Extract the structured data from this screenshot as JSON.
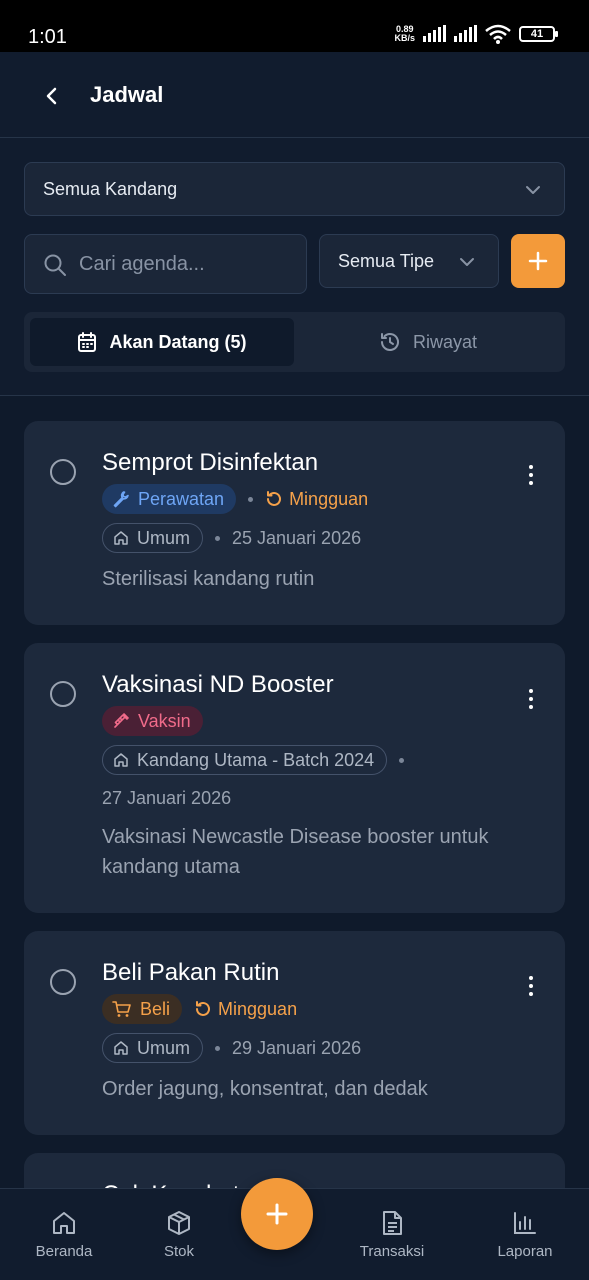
{
  "status_bar": {
    "time": "1:01",
    "net_speed_value": "0.89",
    "net_speed_unit": "KB/s",
    "battery": "41"
  },
  "header": {
    "title": "Jadwal",
    "back_icon": "chevron-left-icon"
  },
  "filters": {
    "kandang_select": "Semua Kandang",
    "search_placeholder": "Cari agenda...",
    "type_select": "Semua Tipe"
  },
  "tabs": [
    {
      "label": "Akan Datang (5)",
      "icon": "calendar-icon",
      "active": true
    },
    {
      "label": "Riwayat",
      "icon": "history-icon",
      "active": false
    }
  ],
  "cards": [
    {
      "title": "Semprot Disinfektan",
      "type_label": "Perawatan",
      "type_icon": "wrench-icon",
      "recurrence": "Mingguan",
      "location": "Umum",
      "date": "25 Januari 2026",
      "description": "Sterilisasi kandang rutin"
    },
    {
      "title": "Vaksinasi ND Booster",
      "type_label": "Vaksin",
      "type_icon": "syringe-icon",
      "recurrence": "",
      "location": "Kandang Utama - Batch 2024",
      "date": "27 Januari 2026",
      "description": "Vaksinasi Newcastle Disease booster untuk kandang utama"
    },
    {
      "title": "Beli Pakan Rutin",
      "type_label": "Beli",
      "type_icon": "cart-icon",
      "recurrence": "Mingguan",
      "location": "Umum",
      "date": "29 Januari 2026",
      "description": "Order jagung, konsentrat, dan dedak"
    },
    {
      "title": "Cek Kesehatan"
    }
  ],
  "bottom_nav": [
    {
      "label": "Beranda",
      "icon": "home-icon"
    },
    {
      "label": "Stok",
      "icon": "box-icon"
    },
    {
      "label": "Transaksi",
      "icon": "document-icon"
    },
    {
      "label": "Laporan",
      "icon": "bar-chart-icon"
    }
  ],
  "colors": {
    "accent": "#f39a3a",
    "background": "#0f1a2b",
    "card": "#1d293c"
  }
}
